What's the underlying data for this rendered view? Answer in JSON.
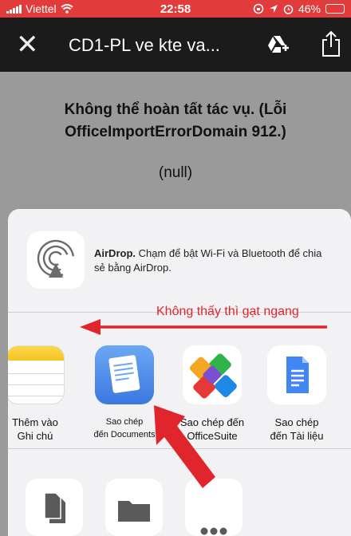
{
  "status_bar": {
    "carrier": "Viettel",
    "time": "22:58",
    "battery": "46%",
    "battery_level": 0.46
  },
  "nav": {
    "close_icon": "close-icon",
    "title": "CD1-PL ve kte va...",
    "drive_icon": "drive-add-icon",
    "share_icon": "share-icon"
  },
  "document": {
    "error_message": "Không thể hoàn tất tác vụ. (Lỗi OfficeImportErrorDomain 912.)",
    "null_text": "(null)"
  },
  "share_sheet": {
    "airdrop": {
      "title": "AirDrop.",
      "description": " Chạm để bật Wi-Fi và Bluetooth để chia sẻ bằng AirDrop."
    },
    "apps": [
      {
        "label_line1": "Thêm vào",
        "label_line2": "Ghi chú",
        "icon": "notes-icon"
      },
      {
        "label_line1": "Sao chép",
        "label_line2": "đến Documents",
        "icon": "documents-icon"
      },
      {
        "label_line1": "Sao chép đến",
        "label_line2": "OfficeSuite",
        "icon": "officesuite-icon"
      },
      {
        "label_line1": "Sao chép",
        "label_line2": "đến Tài liệu",
        "icon": "google-docs-icon"
      }
    ],
    "actions": [
      {
        "icon": "copy-icon"
      },
      {
        "icon": "folder-icon"
      },
      {
        "icon": "more-icon"
      }
    ]
  },
  "annotation": {
    "text": "Không thấy thì gạt ngang",
    "color": "#e0262c"
  },
  "colors": {
    "status_bar": "#e23b3b",
    "nav_bar": "#1b1b1b",
    "sheet": "#f2f2f4"
  }
}
